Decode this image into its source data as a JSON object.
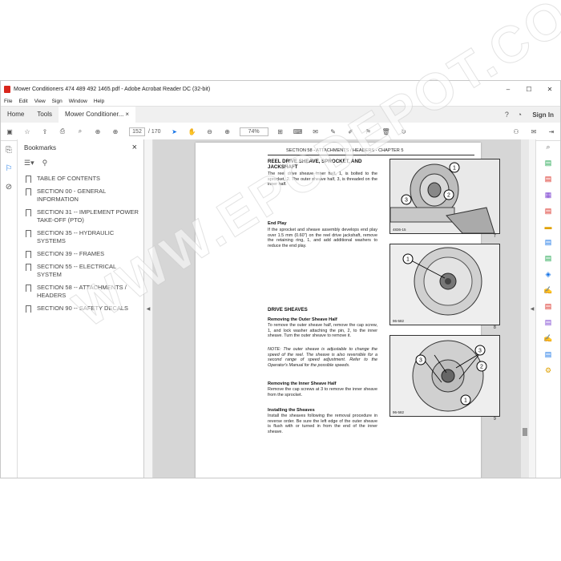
{
  "window": {
    "title": "Mower Conditioners 474 489 492 1465.pdf - Adobe Acrobat Reader DC (32-bit)",
    "minimize": "–",
    "maximize": "☐",
    "close": "✕"
  },
  "menu": [
    "File",
    "Edit",
    "View",
    "Sign",
    "Window",
    "Help"
  ],
  "tabs": {
    "home": "Home",
    "tools": "Tools",
    "doc": "Mower Conditioner...",
    "doc_close": "×",
    "signin": "Sign In"
  },
  "toolbar": {
    "page_current": "152",
    "page_total": "/ 170",
    "zoom": "74%"
  },
  "bookmarks": {
    "title": "Bookmarks",
    "close": "×",
    "items": [
      "TABLE OF CONTENTS",
      "SECTION 00 - GENERAL INFORMATION",
      "SECTION 31 -- IMPLEMENT POWER TAKE-OFF (PTO)",
      "SECTION 35 -- HYDRAULIC SYSTEMS",
      "SECTION 39 -- FRAMES",
      "SECTION 55 -- ELECTRICAL SYSTEM",
      "SECTION 58 -- ATTACHMENTS / HEADERS",
      "SECTION 90 -- SAFETY DECALS"
    ]
  },
  "page": {
    "header": "SECTION 58 - ATTACHMENTS / HEADERS - CHAPTER 5",
    "s1_title": "REEL DRIVE SHEAVE, SPROCKET, AND JACKSHAFT",
    "s1_body": "The reel drive sheave inner half, 1, is bolted to the sprocket, 2. The outer sheave half, 3, is threaded on the inner half.",
    "end_play_title": "End Play",
    "end_play_body": "If the sprocket and sheave assembly develops end play over 1.5 mm (0.60\") on the reel drive jackshaft, remove the retaining ring, 1, and add additional washers to reduce the end play.",
    "s2_title": "DRIVE SHEAVES",
    "remove_outer_title": "Removing the Outer Sheave Half",
    "remove_outer_body": "To remove the outer sheave half, remove the cap screw, 1, and lock washer attaching the pin, 2, to the inner sheave. Turn the outer sheave to remove it.",
    "note": "NOTE: The outer sheave is adjustable to change the speed of the reel. The sheave is also reversible for a second range of speed adjustment. Refer to the Operator's Manual for the possible speeds.",
    "remove_inner_title": "Removing the Inner Sheave Half",
    "remove_inner_body": "Remove the cap screws at 3 to remove the inner sheave from the sprocket.",
    "install_title": "Installing the Sheaves",
    "install_body": "Install the sheaves following the removal procedure in reverse order. Be sure the left edge of the outer sheave is flush with or turned in from the end of the inner sheave.",
    "fig7_num": "7",
    "fig7_code": "4836-15",
    "fig8_num": "8",
    "fig8_code": "96-582",
    "fig9_num": "9",
    "fig9_code": "96-582",
    "callouts": {
      "c1": "1",
      "c2": "2",
      "c3": "3"
    }
  },
  "watermark": "WWW.EPCDEPOT.COM"
}
